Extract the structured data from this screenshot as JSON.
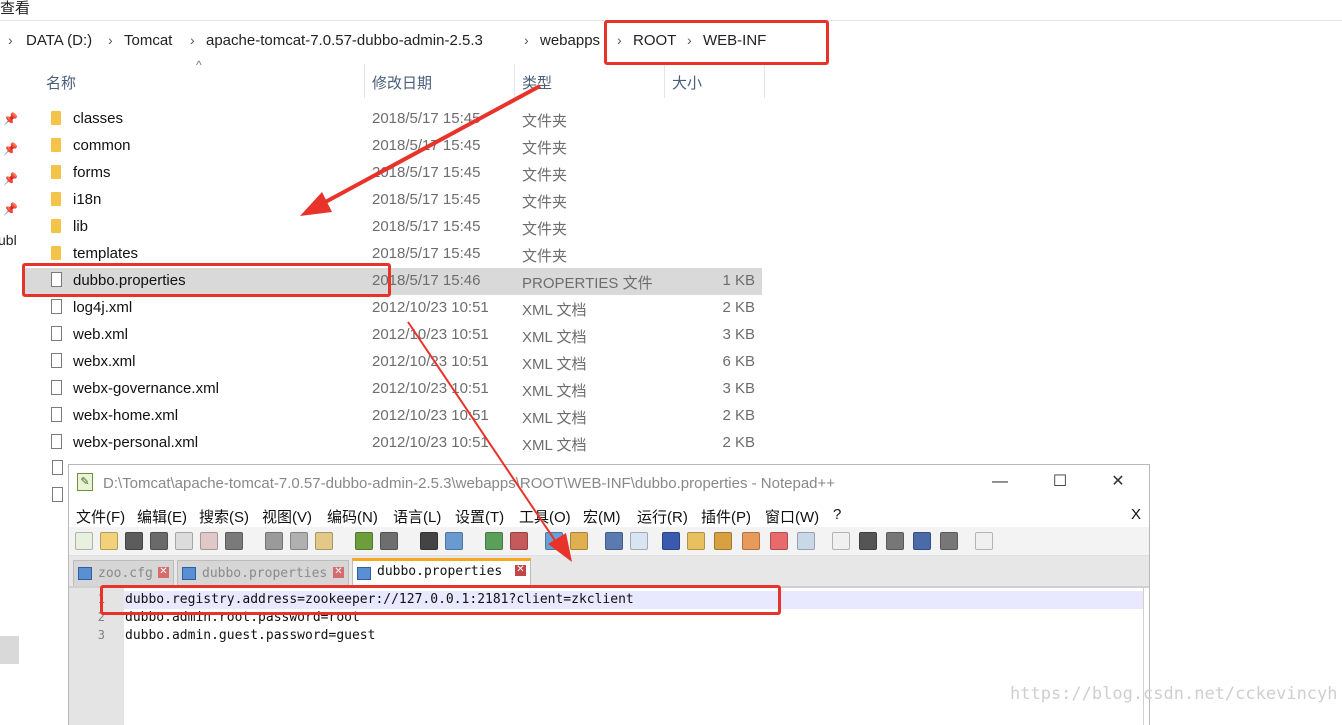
{
  "top_fragment": "查看",
  "breadcrumb": [
    "DATA (D:)",
    "Tomcat",
    "apache-tomcat-7.0.57-dubbo-admin-2.5.3",
    "webapps",
    "ROOT",
    "WEB-INF"
  ],
  "sidebar": {
    "partial_label": "ubl"
  },
  "columns": {
    "name": "名称",
    "date": "修改日期",
    "type": "类型",
    "size": "大小"
  },
  "files": [
    {
      "name": "classes",
      "date": "2018/5/17 15:45",
      "type": "文件夹",
      "size": "",
      "icon": "folder-icon"
    },
    {
      "name": "common",
      "date": "2018/5/17 15:45",
      "type": "文件夹",
      "size": "",
      "icon": "folder-icon"
    },
    {
      "name": "forms",
      "date": "2018/5/17 15:45",
      "type": "文件夹",
      "size": "",
      "icon": "folder-icon"
    },
    {
      "name": "i18n",
      "date": "2018/5/17 15:45",
      "type": "文件夹",
      "size": "",
      "icon": "folder-icon"
    },
    {
      "name": "lib",
      "date": "2018/5/17 15:45",
      "type": "文件夹",
      "size": "",
      "icon": "folder-icon"
    },
    {
      "name": "templates",
      "date": "2018/5/17 15:45",
      "type": "文件夹",
      "size": "",
      "icon": "folder-icon"
    },
    {
      "name": "dubbo.properties",
      "date": "2018/5/17 15:46",
      "type": "PROPERTIES 文件",
      "size": "1 KB",
      "icon": "file-icon",
      "selected": true
    },
    {
      "name": "log4j.xml",
      "date": "2012/10/23 10:51",
      "type": "XML 文档",
      "size": "2 KB",
      "icon": "file-icon"
    },
    {
      "name": "web.xml",
      "date": "2012/10/23 10:51",
      "type": "XML 文档",
      "size": "3 KB",
      "icon": "file-icon"
    },
    {
      "name": "webx.xml",
      "date": "2012/10/23 10:51",
      "type": "XML 文档",
      "size": "6 KB",
      "icon": "file-icon"
    },
    {
      "name": "webx-governance.xml",
      "date": "2012/10/23 10:51",
      "type": "XML 文档",
      "size": "3 KB",
      "icon": "file-icon"
    },
    {
      "name": "webx-home.xml",
      "date": "2012/10/23 10:51",
      "type": "XML 文档",
      "size": "2 KB",
      "icon": "file-icon"
    },
    {
      "name": "webx-personal.xml",
      "date": "2012/10/23 10:51",
      "type": "XML 文档",
      "size": "2 KB",
      "icon": "file-icon"
    }
  ],
  "notepad": {
    "title": "D:\\Tomcat\\apache-tomcat-7.0.57-dubbo-admin-2.5.3\\webapps\\ROOT\\WEB-INF\\dubbo.properties - Notepad++",
    "window_buttons": {
      "minimize": "—",
      "maximize": "☐",
      "close": "✕"
    },
    "menu": [
      "文件(F)",
      "编辑(E)",
      "搜索(S)",
      "视图(V)",
      "编码(N)",
      "语言(L)",
      "设置(T)",
      "工具(O)",
      "宏(M)",
      "运行(R)",
      "插件(P)",
      "窗口(W)",
      "?"
    ],
    "menu_close": "X",
    "tabs": [
      {
        "label": "zoo.cfg",
        "active": false
      },
      {
        "label": "dubbo.properties",
        "active": false
      },
      {
        "label": "dubbo.properties",
        "active": true
      }
    ],
    "tab_close": "✕",
    "lines": [
      {
        "num": "1",
        "text": "dubbo.registry.address=zookeeper://127.0.0.1:2181?client=zkclient"
      },
      {
        "num": "2",
        "text": "dubbo.admin.root.password=root"
      },
      {
        "num": "3",
        "text": "dubbo.admin.guest.password=guest"
      }
    ]
  },
  "watermark": "https://blog.csdn.net/cckevincyh",
  "annotation_color": "#e8332a"
}
